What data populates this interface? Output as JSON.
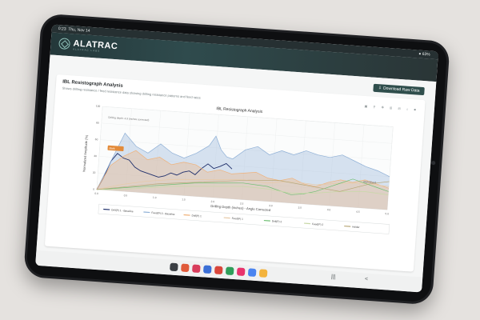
{
  "status_bar": {
    "time": "0:23",
    "date": "Thu, Nov 14",
    "battery": "63%"
  },
  "app": {
    "logo_text": "ALATRAC",
    "logo_sub": "ALATRAC LABS"
  },
  "toolbar": {
    "download_label": "Download Raw Data"
  },
  "card": {
    "title": "IBL Resistograph Analysis",
    "subtitle": "Shows drilling resistance / feed resistance data showing drilling resistance patterns and feed rates"
  },
  "chart_data": {
    "type": "line",
    "title": "IBL Resistograph Analysis",
    "xlabel": "Drilling Depth (inches) - Angle Corrected",
    "ylabel": "Normalized Amplitude (%)",
    "xlim": [
      0,
      4.8
    ],
    "ylim": [
      0,
      100
    ],
    "xticks": [
      "0.0",
      "0.5",
      "1.0",
      "1.5",
      "2.0",
      "2.5",
      "3.0",
      "3.5",
      "4.0",
      "4.5",
      "5.0"
    ],
    "yticks": [
      "0",
      "20",
      "40",
      "60",
      "80",
      "100"
    ],
    "grid": true,
    "legend_position": "bottom",
    "annotations": [
      "Drilling depth: 4.9 (inches corrected)",
      "Bark",
      "Bark/Wood"
    ],
    "series": [
      {
        "name": "Drill(P) 1 - Baseline",
        "color": "#1f2f6b",
        "x": [
          0,
          0.1,
          0.2,
          0.3,
          0.4,
          0.5,
          0.6,
          0.7,
          0.8,
          0.9,
          1.0,
          1.1,
          1.2,
          1.3,
          1.4,
          1.5,
          1.6,
          1.7,
          1.8,
          1.9,
          2.0,
          2.1,
          2.2
        ],
        "y": [
          0,
          15,
          35,
          45,
          40,
          38,
          30,
          26,
          24,
          22,
          20,
          22,
          26,
          24,
          28,
          30,
          26,
          34,
          40,
          35,
          38,
          42,
          36
        ]
      },
      {
        "name": "Feed(P) 0 - Baseline",
        "color": "#8fb0d6",
        "x": [
          0,
          0.2,
          0.4,
          0.6,
          0.8,
          1.0,
          1.2,
          1.4,
          1.6,
          1.8,
          1.9,
          2.0,
          2.1,
          2.2,
          2.4,
          2.6,
          2.8,
          3.0,
          3.2,
          3.4,
          3.6,
          3.8,
          4.0,
          4.2,
          4.4,
          4.6,
          4.8
        ],
        "y": [
          0,
          35,
          70,
          55,
          48,
          60,
          50,
          45,
          52,
          62,
          74,
          58,
          50,
          48,
          60,
          65,
          56,
          62,
          58,
          64,
          60,
          58,
          62,
          56,
          50,
          46,
          40
        ]
      },
      {
        "name": "Drill(P) 1",
        "color": "#f0b27a",
        "x": [
          0,
          0.2,
          0.4,
          0.6,
          0.8,
          1.0,
          1.2,
          1.4,
          1.6,
          1.8,
          2.0,
          2.2,
          2.4,
          2.6,
          2.8,
          3.0,
          3.2,
          3.4,
          3.6,
          3.8,
          4.0,
          4.2,
          4.4,
          4.6,
          4.8
        ],
        "y": [
          0,
          30,
          42,
          50,
          40,
          44,
          36,
          40,
          38,
          30,
          34,
          30,
          32,
          34,
          28,
          26,
          30,
          24,
          22,
          28,
          32,
          30,
          34,
          30,
          26
        ]
      },
      {
        "name": "Feed(P) 1",
        "color": "#e7c9a6",
        "x": [
          0,
          0.4,
          0.8,
          1.2,
          1.6,
          2.0,
          2.4,
          2.8,
          3.2,
          3.6,
          4.0,
          4.4,
          4.8
        ],
        "y": [
          0,
          8,
          14,
          18,
          20,
          22,
          24,
          22,
          26,
          24,
          28,
          30,
          28
        ]
      },
      {
        "name": "Drill(P) 2",
        "color": "#6fbf73",
        "x": [
          0,
          0.4,
          0.8,
          1.2,
          1.6,
          2.0,
          2.4,
          2.8,
          3.0,
          3.2,
          3.4,
          3.6,
          3.8,
          4.0,
          4.2,
          4.4,
          4.6,
          4.8
        ],
        "y": [
          0,
          4,
          8,
          12,
          16,
          18,
          20,
          18,
          14,
          10,
          12,
          16,
          22,
          28,
          34,
          30,
          26,
          22
        ]
      },
      {
        "name": "Feed(P) 2",
        "color": "#c9d9a8",
        "x": [
          0,
          0.4,
          0.8,
          1.2,
          1.6,
          2.0,
          2.4,
          2.8,
          3.2,
          3.6,
          4.0,
          4.4,
          4.8
        ],
        "y": [
          0,
          2,
          6,
          10,
          12,
          14,
          16,
          15,
          12,
          14,
          18,
          20,
          18
        ]
      },
      {
        "name": "Holder",
        "color": "#b8a878",
        "x": [
          0,
          0.5,
          1.0,
          1.5,
          2.0,
          2.5,
          3.0,
          3.5,
          4.0,
          4.5,
          4.8
        ],
        "y": [
          0,
          6,
          12,
          16,
          20,
          24,
          26,
          22,
          18,
          30,
          34
        ]
      }
    ]
  },
  "nav": {
    "recent": "|||",
    "back": "<"
  }
}
